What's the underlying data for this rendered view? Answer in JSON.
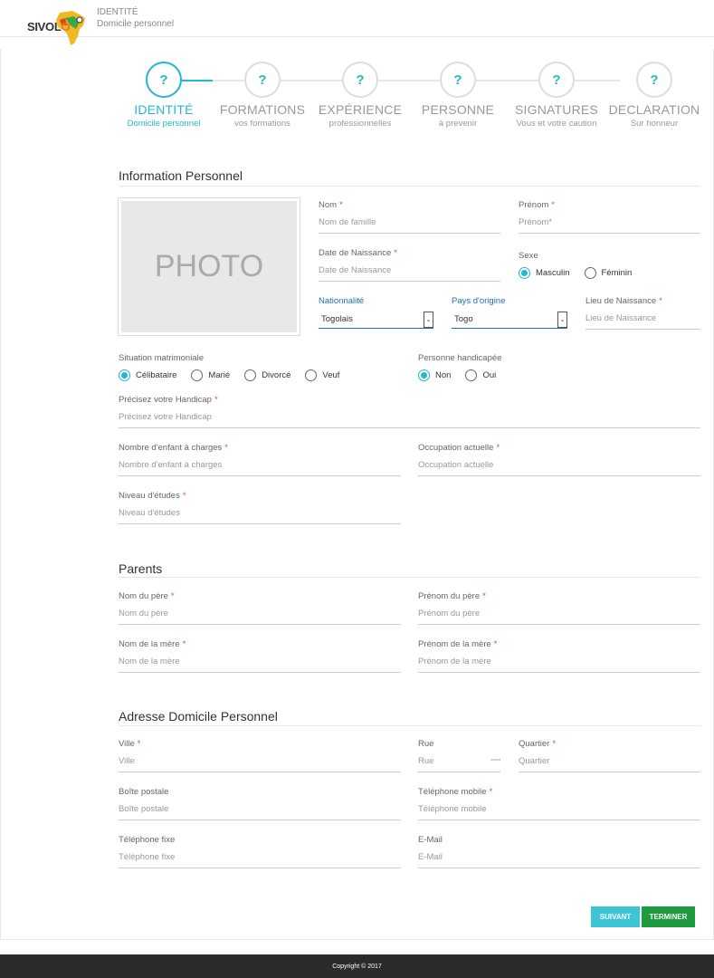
{
  "header": {
    "logo_prefix": "SIVOL",
    "logo_suffix": "O",
    "breadcrumb_title": "IDENTITÉ",
    "breadcrumb_sub": "Domicile personnel"
  },
  "steps": [
    {
      "icon": "?",
      "label": "IDENTITÉ",
      "sub": "Domicile personnel",
      "active": true
    },
    {
      "icon": "?",
      "label": "FORMATIONS",
      "sub": "vos formations",
      "active": false
    },
    {
      "icon": "?",
      "label": "EXPÉRIENCE",
      "sub": "professionnelles",
      "active": false
    },
    {
      "icon": "?",
      "label": "PERSONNE",
      "sub": "à prevenir",
      "active": false
    },
    {
      "icon": "?",
      "label": "SIGNATURES",
      "sub": "Vous et votre caution",
      "active": false
    },
    {
      "icon": "?",
      "label": "DECLARATION",
      "sub": "Sur honneur",
      "active": false
    }
  ],
  "personal": {
    "title": "Information Personnel",
    "photo_text": "PHOTO",
    "nom": {
      "label": "Nom",
      "placeholder": "Nom de famille"
    },
    "prenom": {
      "label": "Prénom",
      "placeholder": "Prénom*"
    },
    "naissance": {
      "label": "Date de Naissance",
      "placeholder": "Date de Naissance"
    },
    "sexe": {
      "label": "Sexe",
      "options": [
        "Masculin",
        "Féminin"
      ],
      "selected": "Masculin"
    },
    "nationalite": {
      "label": "Nationnalité",
      "value": "Togolais"
    },
    "pays": {
      "label": "Pays d'origine",
      "value": "Togo"
    },
    "lieu": {
      "label": "Lieu de Naissance",
      "placeholder": "Lieu de Naissance"
    },
    "situation": {
      "label": "Situation matrimoniale",
      "options": [
        "Célibataire",
        "Marié",
        "Divorcé",
        "Veuf"
      ],
      "selected": "Célibataire"
    },
    "handicape": {
      "label": "Personne handicapée",
      "options": [
        "Non",
        "Oui"
      ],
      "selected": "Non"
    },
    "handicap_detail": {
      "label": "Précisez votre Handicap",
      "placeholder": "Précisez votre Handicap"
    },
    "enfants": {
      "label": "Nombre d'enfant à charges",
      "placeholder": "Nombre d'enfant à charges"
    },
    "occupation": {
      "label": "Occupation actuelle",
      "placeholder": "Occupation actuelle"
    },
    "etudes": {
      "label": "Niveau d'études",
      "placeholder": "Niveau d'études"
    }
  },
  "parents": {
    "title": "Parents",
    "nom_pere": {
      "label": "Nom du père",
      "placeholder": "Nom du père"
    },
    "prenom_pere": {
      "label": "Prénom du père",
      "placeholder": "Prénom du père"
    },
    "nom_mere": {
      "label": "Nom de la mère",
      "placeholder": "Nom de la mère"
    },
    "prenom_mere": {
      "label": "Prénom de la mère",
      "placeholder": "Prénom de la mère"
    }
  },
  "address": {
    "title": "Adresse Domicile Personnel",
    "ville": {
      "label": "Ville",
      "placeholder": "Ville"
    },
    "rue": {
      "label": "Rue",
      "placeholder": "Rue"
    },
    "quartier": {
      "label": "Quartier",
      "placeholder": "Quartier"
    },
    "boite": {
      "label": "Boîte postale",
      "placeholder": "Boîte postale"
    },
    "mobile": {
      "label": "Téléphone mobile",
      "placeholder": "Téléphone mobile"
    },
    "fixe": {
      "label": "Téléphone fixe",
      "placeholder": "Téléphone fixe"
    },
    "email": {
      "label": "E-Mail",
      "placeholder": "E-Mail"
    }
  },
  "buttons": {
    "next": "SUIVANT",
    "finish": "TERMINER"
  },
  "footer": {
    "copyright": "Copyright © 2017"
  },
  "colors": {
    "accent": "#22b8cf",
    "success": "#1e9b3f",
    "link": "#1f6fb2",
    "required": "#e74c3c"
  }
}
